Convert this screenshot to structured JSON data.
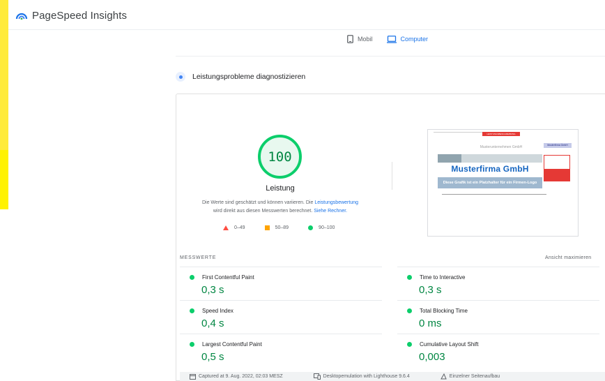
{
  "header": {
    "app_title": "PageSpeed Insights",
    "logo_icon": "pagespeed-logo-icon"
  },
  "device_tabs": [
    {
      "label": "Mobil",
      "icon": "mobile-phone-icon",
      "active": false
    },
    {
      "label": "Computer",
      "icon": "desktop-computer-icon",
      "active": true
    }
  ],
  "diagnose": {
    "title": "Leistungsprobleme diagnostizieren"
  },
  "score": {
    "value": "100",
    "label": "Leistung",
    "note_text_1": "Die Werte sind geschätzt und können variieren. Die",
    "note_link_1": "Leistungsbewertung",
    "note_text_2": "wird direkt aus diesen Messwerten berechnet.",
    "note_link_2": "Siehe Rechner.",
    "colors": {
      "good": "#0cce6b",
      "average": "#ffa400",
      "fail": "#ff4e42"
    }
  },
  "legend": [
    {
      "label": "0–49",
      "shape": "triangle"
    },
    {
      "label": "50–89",
      "shape": "square"
    },
    {
      "label": "90–100",
      "shape": "circle"
    }
  ],
  "screenshot": {
    "top_tab": "LEISTUNGSBESCHREIBUNG",
    "subtitle": "Musterunternehmen GmbH",
    "side_label": "Musterfirma GmbH",
    "brand": "Musterfirma GmbH",
    "banner": "Diese Grafik ist ein Platzhalter für ein Firmen-Logo"
  },
  "metrics": {
    "heading": "MESSWERTE",
    "expand_label": "Ansicht maximieren",
    "items": [
      {
        "label": "First Contentful Paint",
        "value": "0,3 s"
      },
      {
        "label": "Time to Interactive",
        "value": "0,3 s"
      },
      {
        "label": "Speed Index",
        "value": "0,4 s"
      },
      {
        "label": "Total Blocking Time",
        "value": "0 ms"
      },
      {
        "label": "Largest Contentful Paint",
        "value": "0,5 s"
      },
      {
        "label": "Cumulative Layout Shift",
        "value": "0,003"
      }
    ]
  },
  "footer": {
    "captured": "Captured at 9. Aug. 2022, 02:03 MESZ",
    "emulation": "Desktopemulation with Lighthouse 9.6.4",
    "load": "Einzelner Seitenaufbau"
  }
}
